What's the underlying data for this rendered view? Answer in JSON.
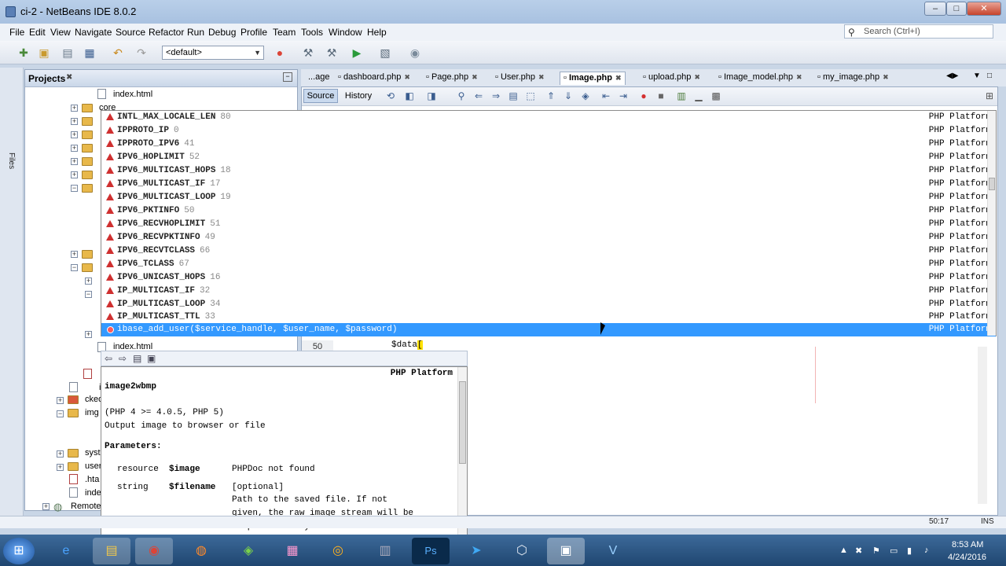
{
  "window": {
    "title": "ci-2 - NetBeans IDE 8.0.2",
    "controls": [
      "–",
      "□",
      "✕"
    ]
  },
  "menu": [
    "File",
    "Edit",
    "View",
    "Navigate",
    "Source",
    "Refactor",
    "Run",
    "Debug",
    "Profile",
    "Team",
    "Tools",
    "Window",
    "Help"
  ],
  "search": {
    "placeholder": "Search (Ctrl+I)"
  },
  "toolbar": {
    "config": "<default>"
  },
  "sidebar": {
    "files_tab": "Files"
  },
  "projects": {
    "title": "Projects",
    "close": "✖",
    "items": [
      {
        "label": "index.html"
      },
      {
        "label": "core"
      },
      {
        "label": "index.html"
      },
      {
        "label": "i"
      },
      {
        "label": "cked"
      },
      {
        "label": "img"
      },
      {
        "label": "syst"
      },
      {
        "label": "user"
      },
      {
        "label": ".hta"
      },
      {
        "label": "inde"
      },
      {
        "label": "Remote"
      }
    ]
  },
  "editor": {
    "tabs": [
      {
        "label": "...age",
        "active": false
      },
      {
        "label": "dashboard.php",
        "active": false
      },
      {
        "label": "Page.php",
        "active": false
      },
      {
        "label": "User.php",
        "active": false
      },
      {
        "label": "Image.php",
        "active": true
      },
      {
        "label": "upload.php",
        "active": false
      },
      {
        "label": "Image_model.php",
        "active": false
      },
      {
        "label": "my_image.php",
        "active": false
      }
    ],
    "source_label": "Source",
    "history_label": "History",
    "line_number": "50",
    "code_text": "$data",
    "caret_char": "["
  },
  "completion": {
    "items": [
      {
        "name": "INTL_MAX_LOCALE_LEN",
        "value": "80",
        "platform": "PHP Platform"
      },
      {
        "name": "IPPROTO_IP",
        "value": "0",
        "platform": "PHP Platform"
      },
      {
        "name": "IPPROTO_IPV6",
        "value": "41",
        "platform": "PHP Platform"
      },
      {
        "name": "IPV6_HOPLIMIT",
        "value": "52",
        "platform": "PHP Platform"
      },
      {
        "name": "IPV6_MULTICAST_HOPS",
        "value": "18",
        "platform": "PHP Platform"
      },
      {
        "name": "IPV6_MULTICAST_IF",
        "value": "17",
        "platform": "PHP Platform"
      },
      {
        "name": "IPV6_MULTICAST_LOOP",
        "value": "19",
        "platform": "PHP Platform"
      },
      {
        "name": "IPV6_PKTINFO",
        "value": "50",
        "platform": "PHP Platform"
      },
      {
        "name": "IPV6_RECVHOPLIMIT",
        "value": "51",
        "platform": "PHP Platform"
      },
      {
        "name": "IPV6_RECVPKTINFO",
        "value": "49",
        "platform": "PHP Platform"
      },
      {
        "name": "IPV6_RECVTCLASS",
        "value": "66",
        "platform": "PHP Platform"
      },
      {
        "name": "IPV6_TCLASS",
        "value": "67",
        "platform": "PHP Platform"
      },
      {
        "name": "IPV6_UNICAST_HOPS",
        "value": "16",
        "platform": "PHP Platform"
      },
      {
        "name": "IP_MULTICAST_IF",
        "value": "32",
        "platform": "PHP Platform"
      },
      {
        "name": "IP_MULTICAST_LOOP",
        "value": "34",
        "platform": "PHP Platform"
      },
      {
        "name": "IP_MULTICAST_TTL",
        "value": "33",
        "platform": "PHP Platform"
      }
    ],
    "selected": {
      "name": "ibase_add_user($service_handle, $user_name, $password)",
      "platform": "PHP Platform"
    }
  },
  "doc": {
    "platform": "PHP Platform",
    "function_name": "image2wbmp",
    "version": "(PHP 4 >= 4.0.5, PHP 5)",
    "description": "Output image to browser or file",
    "params_heading": "Parameters:",
    "params": [
      {
        "type": "resource",
        "name": "$image",
        "desc": "PHPDoc not found"
      },
      {
        "type": "string",
        "name": "$filename",
        "desc": "[optional]"
      }
    ],
    "filename_desc": [
      "Path to the saved file. If not",
      "given, the raw image stream will be",
      "output directly."
    ]
  },
  "statusbar": {
    "position": "50:17",
    "mode": "INS"
  },
  "taskbar": {
    "time": "8:53 AM",
    "date": "4/24/2016",
    "apps": [
      "start-orb",
      "ie",
      "explorer",
      "chrome",
      "firefox",
      "app-green",
      "app-pink",
      "media",
      "app-gray",
      "photoshop",
      "telegram",
      "app-3d",
      "netbeans",
      "vs"
    ]
  }
}
